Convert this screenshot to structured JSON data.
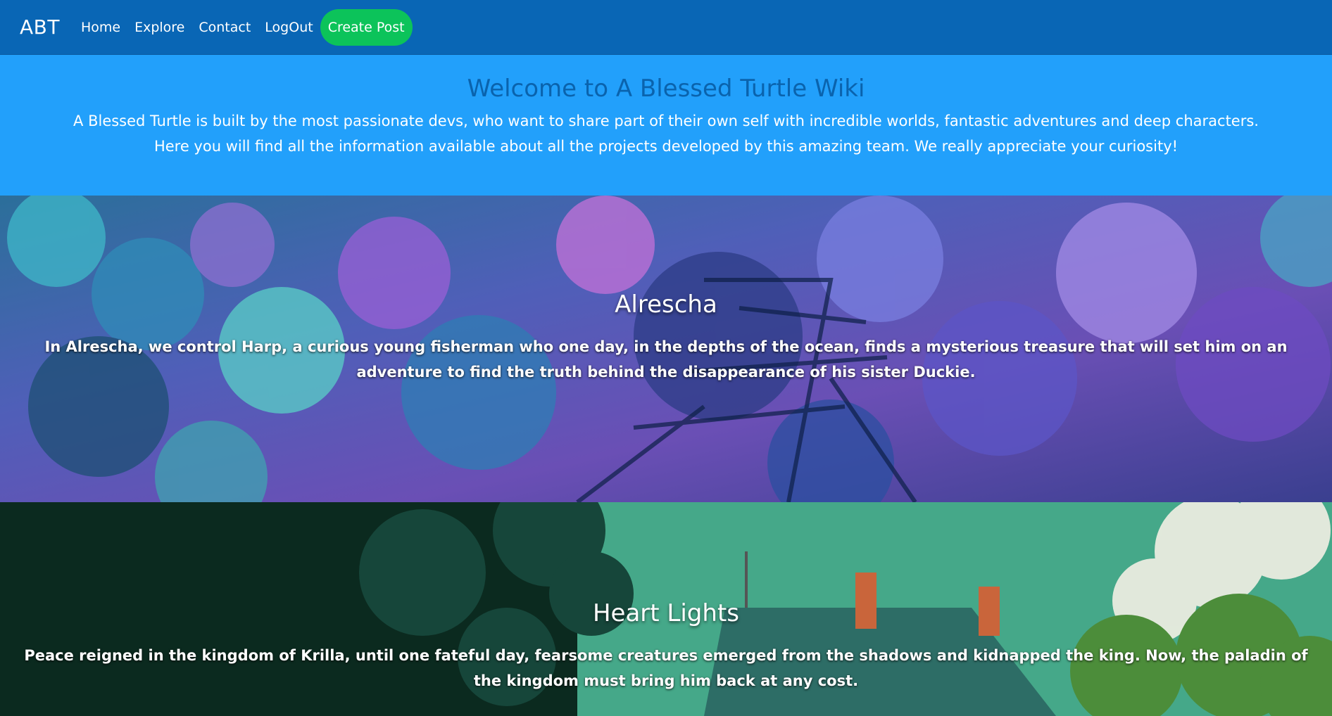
{
  "navbar": {
    "brand": "ABT",
    "links": [
      "Home",
      "Explore",
      "Contact",
      "LogOut"
    ],
    "create_button": "Create Post",
    "colors": {
      "bar": "#0966b5",
      "button": "#0cc35a"
    }
  },
  "hero": {
    "title": "Welcome to A Blessed Turtle Wiki",
    "line1": "A Blessed Turtle is built by the most passionate devs, who want to share part of their own self with incredible worlds, fantastic adventures and deep characters.",
    "line2": "Here you will find all the information available about all the projects developed by this amazing team. We really appreciate your curiosity!",
    "colors": {
      "background": "#22a0fb",
      "title": "#0a63ad"
    }
  },
  "projects": [
    {
      "title": "Alrescha",
      "description": "In Alrescha, we control Harp, a curious young fisherman who one day, in the depths of the ocean, finds a mysterious treasure that will set him on an adventure to find the truth behind the disappearance of his sister Duckie."
    },
    {
      "title": "Heart Lights",
      "description": "Peace reigned in the kingdom of Krilla, until one fateful day, fearsome creatures emerged from the shadows and kidnapped the king. Now, the paladin of the kingdom must bring him back at any cost."
    }
  ]
}
